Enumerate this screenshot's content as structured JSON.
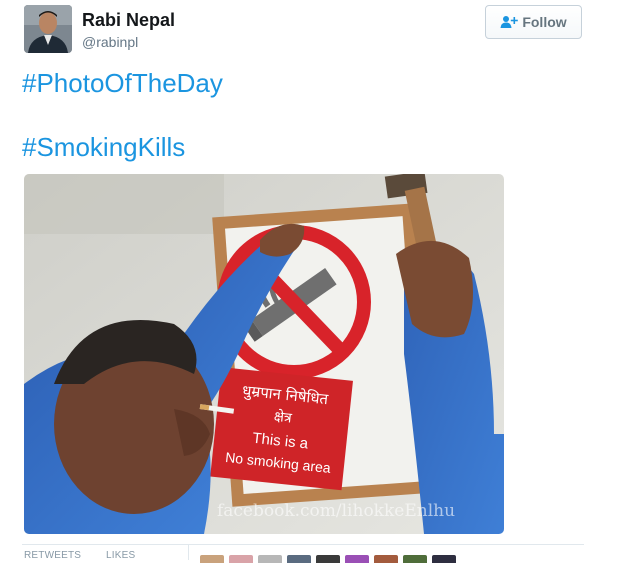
{
  "user": {
    "display_name": "Rabi Nepal",
    "username": "@rabinpl",
    "avatar_icon": "user-avatar"
  },
  "follow_button": {
    "label": "Follow",
    "icon": "add-user-icon"
  },
  "tweet": {
    "hashtags": [
      "#PhotoOfTheDay",
      "#SmokingKills"
    ],
    "photo": {
      "sign_line1": "धुम्रपान निषेधित",
      "sign_line2": "क्षेत्र",
      "sign_line3": "This is a",
      "sign_line4": "No smoking area",
      "watermark": "facebook.com/lihokkeEnlhu"
    }
  },
  "stats": {
    "retweets_label": "RETWEETS",
    "likes_label": "LIKES"
  },
  "colors": {
    "link": "#1b95e0",
    "no_smoking_red": "#d8232a",
    "muted": "#657786"
  }
}
